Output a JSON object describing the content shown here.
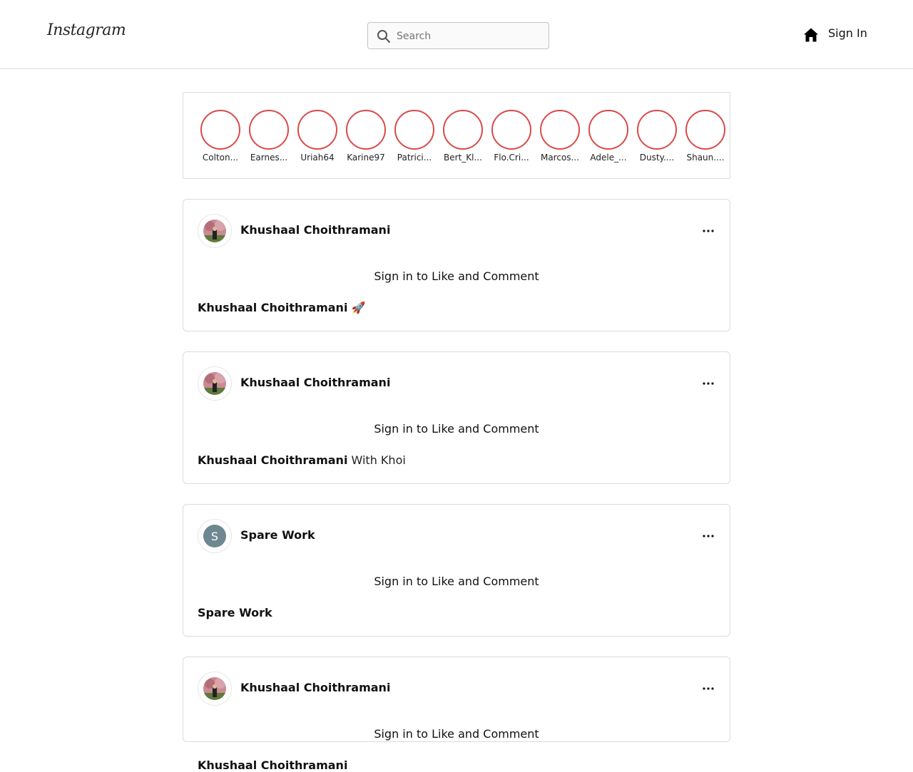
{
  "header": {
    "logo_text": "Instagram",
    "search_placeholder": "Search",
    "signin_label": "Sign In",
    "icons": {
      "search": "search-icon",
      "home": "home-icon"
    }
  },
  "stories": [
    {
      "name": "Colton..."
    },
    {
      "name": "Earnes..."
    },
    {
      "name": "Uriah64"
    },
    {
      "name": "Karine97"
    },
    {
      "name": "Patrici..."
    },
    {
      "name": "Bert_Kl..."
    },
    {
      "name": "Flo.Cri..."
    },
    {
      "name": "Marcos..."
    },
    {
      "name": "Adele_..."
    },
    {
      "name": "Dusty...."
    },
    {
      "name": "Shaun...."
    }
  ],
  "colors": {
    "story_ring": "#d94a4a",
    "letter_avatar": "#6f8790",
    "border": "#dbdbdb"
  },
  "posts": [
    {
      "username": "Khushaal Choithramani",
      "avatar": "photo",
      "signin_message": "Sign in to Like and Comment",
      "caption_user": "Khushaal Choithramani",
      "caption_text": "🚀"
    },
    {
      "username": "Khushaal Choithramani",
      "avatar": "photo",
      "signin_message": "Sign in to Like and Comment",
      "caption_user": "Khushaal Choithramani",
      "caption_text": "With Khoi"
    },
    {
      "username": "Spare Work",
      "avatar": "letter",
      "avatar_letter": "S",
      "signin_message": "Sign in to Like and Comment",
      "caption_user": "Spare Work",
      "caption_text": ""
    },
    {
      "username": "Khushaal Choithramani",
      "avatar": "photo",
      "signin_message": "Sign in to Like and Comment",
      "caption_user": "Khushaal Choithramani",
      "caption_text": ""
    }
  ]
}
